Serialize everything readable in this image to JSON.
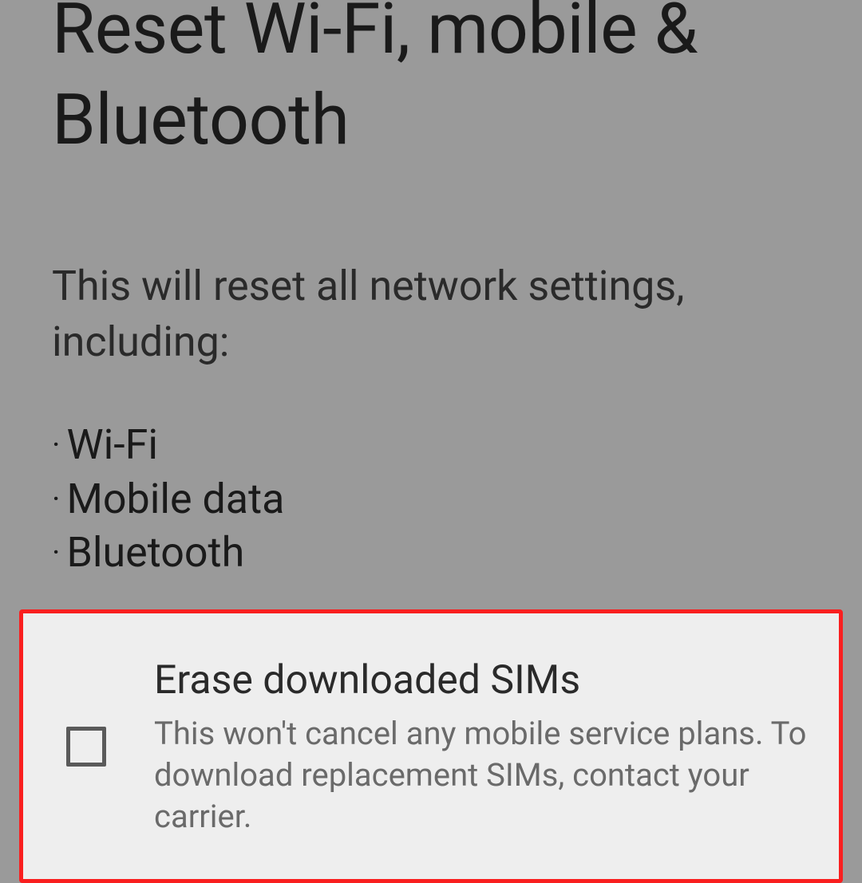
{
  "header": {
    "title": "Reset Wi-Fi, mobile & Bluetooth"
  },
  "description": "This will reset all network settings, including:",
  "bullets": [
    "Wi-Fi",
    "Mobile data",
    "Bluetooth"
  ],
  "option": {
    "title": "Erase downloaded SIMs",
    "subtitle": "This won't cancel any mobile service plans. To download replacement SIMs, contact your carrier.",
    "checked": false
  },
  "colors": {
    "highlight_border": "#f91f1f",
    "card_background": "#eeeeee",
    "page_background": "#9a9a9a"
  }
}
